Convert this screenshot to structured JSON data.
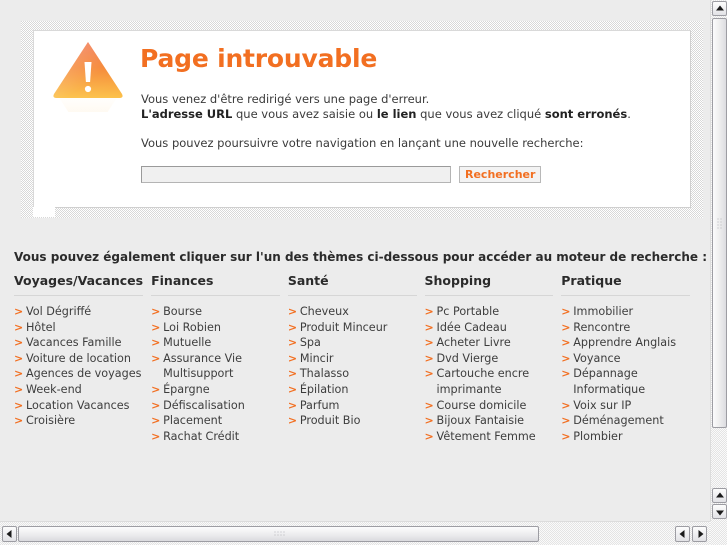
{
  "error_card": {
    "icon": "warning-triangle-icon",
    "title": "Page introuvable",
    "body_line1": "Vous venez d'être redirigé vers une page d'erreur.",
    "body_line2_part1": "L'adresse URL",
    "body_line2_part2": " que vous avez saisie ou ",
    "body_line2_part3": "le lien",
    "body_line2_part4": " que vous avez cliqué ",
    "body_line2_part5": "sont erronés",
    "body_line2_part6": ".",
    "prompt": "Vous pouvez poursuivre votre navigation en lançant une nouvelle recherche:",
    "search_value": "",
    "search_placeholder": "",
    "search_button": "Rechercher"
  },
  "themes": {
    "intro": "Vous pouvez également cliquer sur l'un des thèmes ci-dessous pour accéder au moteur de recherche :",
    "columns": [
      {
        "title": "Voyages/Vacances",
        "links": [
          "Vol Dégriffé",
          "Hôtel",
          "Vacances Famille",
          "Voiture de location",
          "Agences de voyages",
          "Week-end",
          "Location Vacances",
          "Croisière"
        ]
      },
      {
        "title": "Finances",
        "links": [
          "Bourse",
          "Loi Robien",
          "Mutuelle",
          "Assurance Vie Multisupport",
          "Épargne",
          "Défiscalisation",
          "Placement",
          "Rachat Crédit"
        ]
      },
      {
        "title": "Santé",
        "links": [
          "Cheveux",
          "Produit Minceur",
          "Spa",
          "Mincir",
          "Thalasso",
          "Épilation",
          "Parfum",
          "Produit Bio"
        ]
      },
      {
        "title": "Shopping",
        "links": [
          "Pc Portable",
          "Idée Cadeau",
          "Acheter Livre",
          "Dvd Vierge",
          "Cartouche encre imprimante",
          "Course domicile",
          "Bijoux Fantaisie",
          "Vêtement Femme"
        ]
      },
      {
        "title": "Pratique",
        "links": [
          "Immobilier",
          "Rencontre",
          "Apprendre Anglais",
          "Voyance",
          "Dépannage Informatique",
          "Voix sur IP",
          "Déménagement",
          "Plombier"
        ]
      }
    ]
  },
  "colors": {
    "accent_orange": "#f26f21",
    "text_dark": "#3a3a3a",
    "page_background": "#ececec"
  },
  "scrollbars": {
    "vertical": {
      "up_arrow": "▲",
      "down_arrow": "▼"
    },
    "horizontal": {
      "left_arrow": "◀",
      "right_arrow": "▶"
    }
  }
}
